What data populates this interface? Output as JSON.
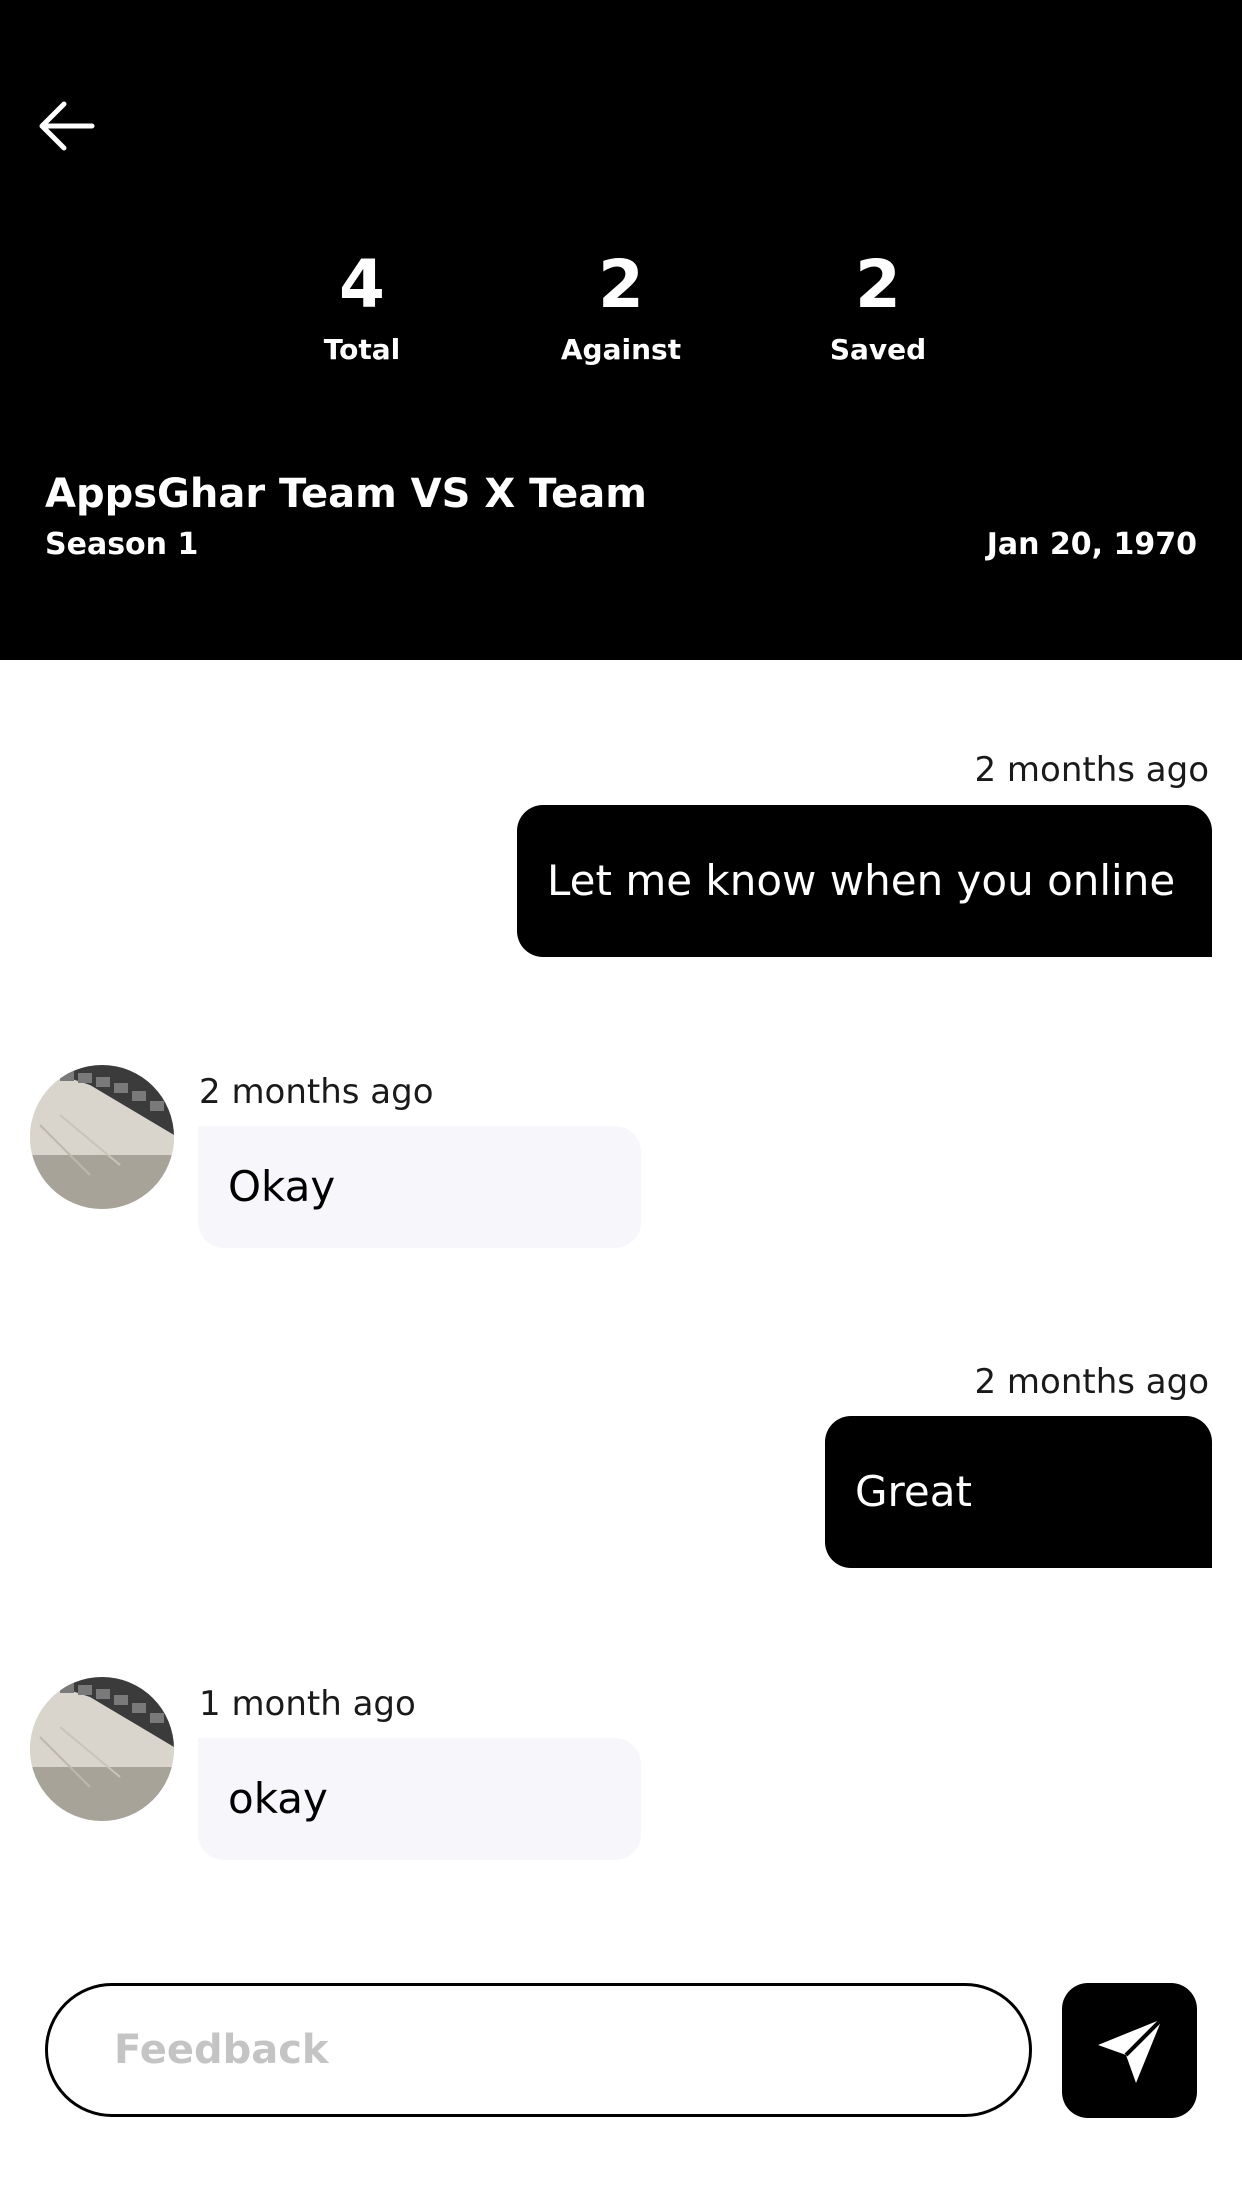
{
  "header": {
    "stats": [
      {
        "value": "4",
        "label": "Total"
      },
      {
        "value": "2",
        "label": "Against"
      },
      {
        "value": "2",
        "label": "Saved"
      }
    ],
    "match_title": "AppsGhar Team VS X Team",
    "season": "Season 1",
    "date": "Jan 20, 1970"
  },
  "messages": [
    {
      "direction": "outgoing",
      "time": "2 months ago",
      "text": "Let me know when you online"
    },
    {
      "direction": "incoming",
      "time": "2 months ago",
      "text": "Okay"
    },
    {
      "direction": "outgoing",
      "time": "2 months ago",
      "text": "Great"
    },
    {
      "direction": "incoming",
      "time": "1 month ago",
      "text": "okay"
    }
  ],
  "composer": {
    "placeholder": "Feedback",
    "value": ""
  },
  "colors": {
    "header_bg": "#000000",
    "outgoing_bubble": "#000000",
    "incoming_bubble": "#f7f7fb",
    "placeholder": "#c4c4c4"
  },
  "icons": {
    "back": "arrow-left-icon",
    "send": "paper-plane-icon"
  }
}
